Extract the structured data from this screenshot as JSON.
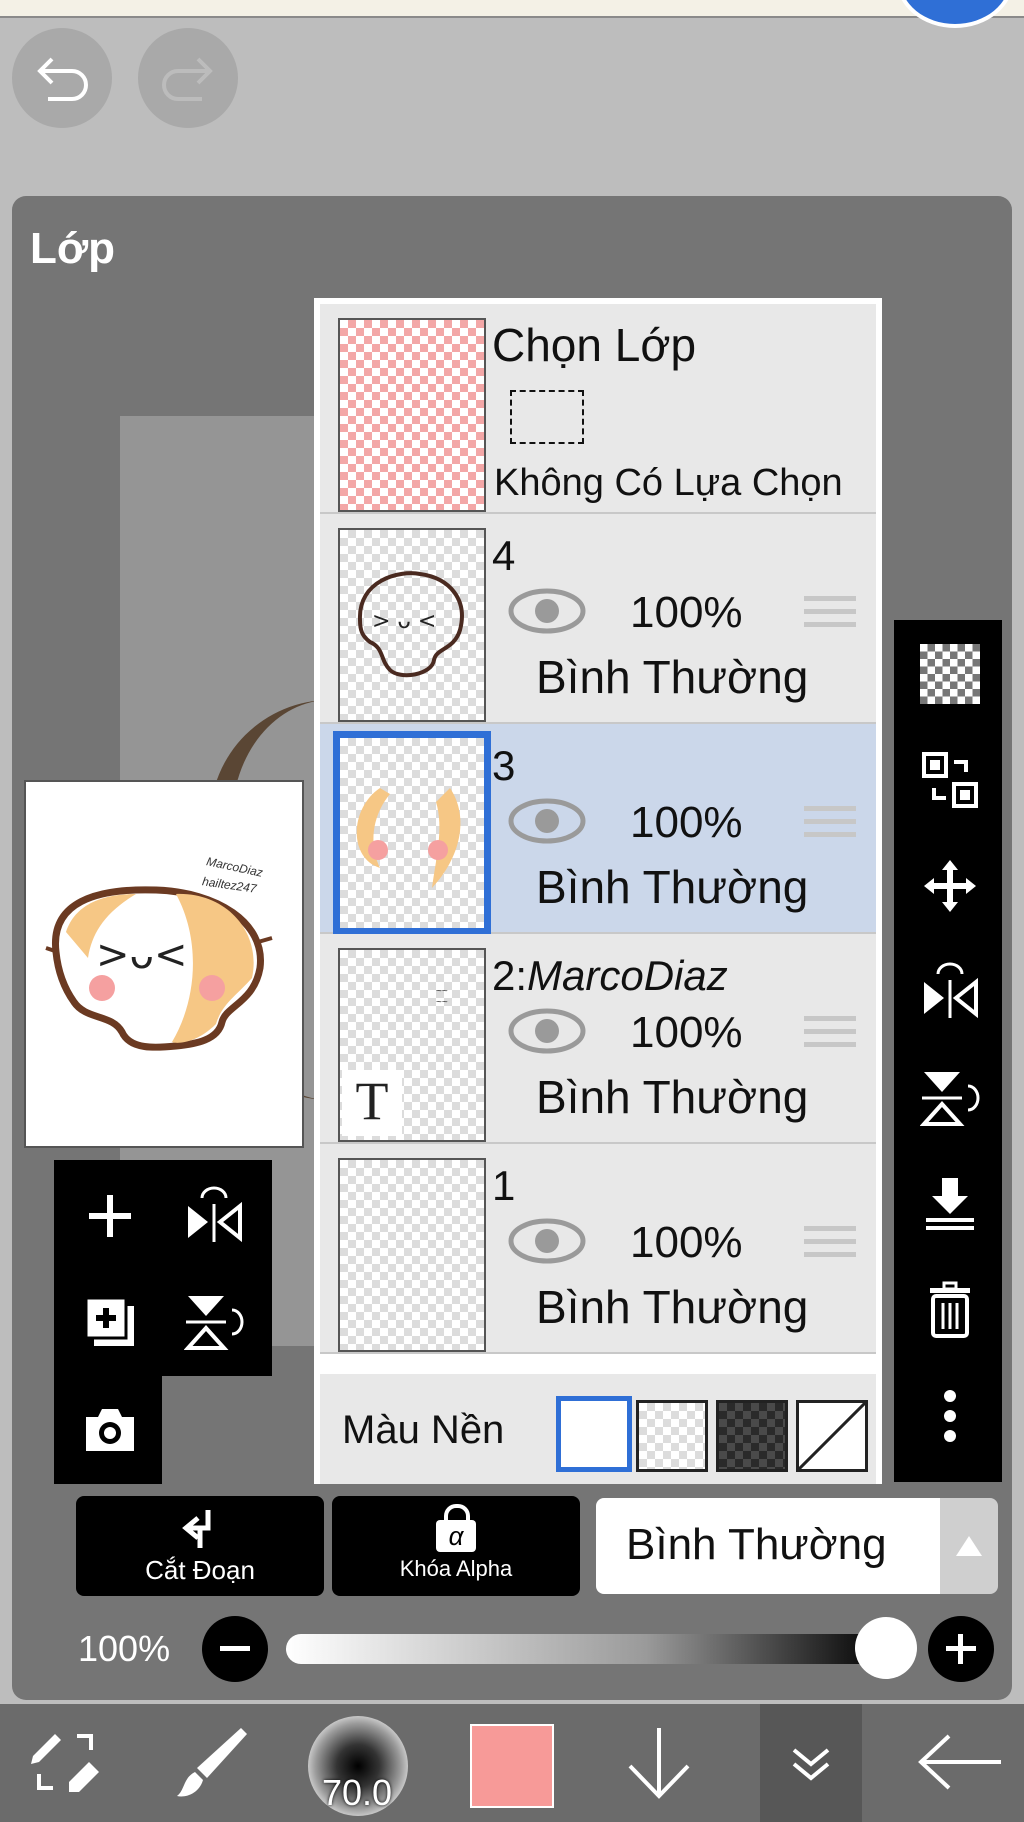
{
  "panel": {
    "title": "Lớp"
  },
  "selection_layer": {
    "title": "Chọn Lớp",
    "status": "Không Có Lựa Chọn"
  },
  "layers": [
    {
      "name": "4",
      "opacity": "100%",
      "blend": "Bình Thường",
      "visible": true,
      "selected": false
    },
    {
      "name": "3",
      "opacity": "100%",
      "blend": "Bình Thường",
      "visible": true,
      "selected": true
    },
    {
      "name": "2:",
      "name_italic": "MarcoDiaz",
      "opacity": "100%",
      "blend": "Bình Thường",
      "visible": true,
      "selected": false,
      "type": "text",
      "text_glyph": "T"
    },
    {
      "name": "1",
      "opacity": "100%",
      "blend": "Bình Thường",
      "visible": true,
      "selected": false
    }
  ],
  "background_color": {
    "label": "Màu Nền",
    "options": [
      "white",
      "checker-light",
      "checker-dark",
      "none"
    ],
    "selected": "white"
  },
  "preview": {
    "signature_line1": "MarcoDiaz",
    "signature_line2": "hailtez247"
  },
  "actions": {
    "clip_label": "Cắt Đoạn",
    "alpha_lock_label": "Khóa Alpha",
    "alpha_glyph": "α",
    "blend_mode": "Bình Thường"
  },
  "opacity_slider": {
    "label": "100%",
    "value": 1.0
  },
  "bottom_toolbar": {
    "brush_size": "70.0",
    "current_color": "#f79a98"
  },
  "colors": {
    "selected_row": "#cbd7ea",
    "accent": "#2f6fd6",
    "panel": "#757575"
  }
}
